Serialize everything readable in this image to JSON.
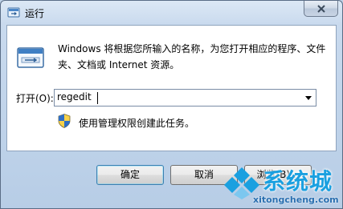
{
  "window": {
    "title": "运行",
    "close_icon": "close-icon",
    "title_icon": "run-icon"
  },
  "dialog": {
    "description": "Windows 将根据您所输入的名称，为您打开相应的程序、文件夹、文档或 Internet 资源。",
    "open_label": "打开(O):",
    "input_value": "regedit",
    "admin_note": "使用管理权限创建此任务。"
  },
  "buttons": {
    "ok": "确定",
    "cancel": "取消",
    "browse": "浏览(B)..."
  },
  "watermark": {
    "brand_cn": "系统城",
    "brand_url": "xitongcheng.com",
    "accent": "#1aa0e0"
  }
}
